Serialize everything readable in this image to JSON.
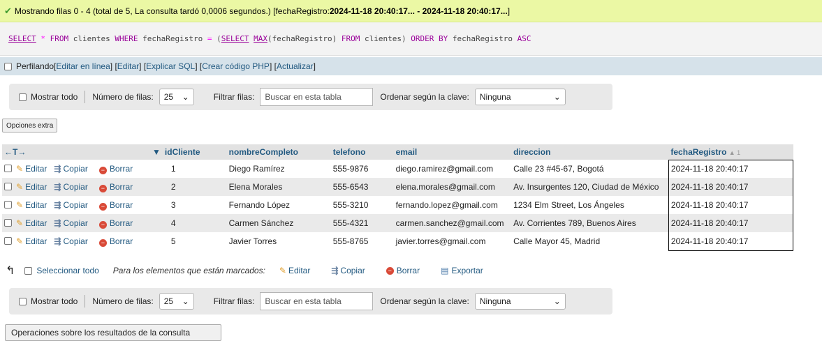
{
  "success": {
    "text": "Mostrando filas 0 - 4 (total de 5, La consulta tardó 0,0006 segundos.) [fechaRegistro: ",
    "range": "2024-11-18 20:40:17... - 2024-11-18 20:40:17...",
    "close": "]"
  },
  "sql": {
    "select": "SELECT",
    "star": "*",
    "from1": "FROM",
    "table1": "clientes",
    "where": "WHERE",
    "col1": "fechaRegistro",
    "eq": "=",
    "open": "(",
    "select2": "SELECT",
    "max": "MAX",
    "col2": "(fechaRegistro)",
    "from2": "FROM",
    "table2": "clientes",
    "close": ")",
    "orderby": "ORDER BY",
    "col3": "fechaRegistro",
    "asc": "ASC"
  },
  "profiling": {
    "label": "Perfilando",
    "open": " [ ",
    "edit_inline": "Editar en línea",
    "mid1": " ] [ ",
    "edit": "Editar",
    "mid2": " ] [ ",
    "explain": "Explicar SQL",
    "mid3": " ] [ ",
    "php": "Crear código PHP",
    "mid4": " ] [ ",
    "refresh": "Actualizar",
    "end": " ]"
  },
  "nav": {
    "show_all": "Mostrar todo",
    "rows_label": "Número de filas:",
    "rows_value": "25",
    "filter_label": "Filtrar filas:",
    "filter_placeholder": "Buscar en esta tabla",
    "sort_label": "Ordenar según la clave:",
    "sort_value": "Ninguna"
  },
  "extra_options": "Opciones extra",
  "columns": {
    "arrows": "←T→",
    "id": "idCliente",
    "name": "nombreCompleto",
    "phone": "telefono",
    "email": "email",
    "address": "direccion",
    "date": "fechaRegistro",
    "sort_badge": "▲ 1"
  },
  "actions": {
    "edit": "Editar",
    "copy": "Copiar",
    "delete": "Borrar"
  },
  "rows": [
    {
      "id": "1",
      "name": "Diego Ramírez",
      "phone": "555-9876",
      "email": "diego.ramirez@gmail.com",
      "address": "Calle 23 #45-67, Bogotá",
      "date": "2024-11-18 20:40:17"
    },
    {
      "id": "2",
      "name": "Elena Morales",
      "phone": "555-6543",
      "email": "elena.morales@gmail.com",
      "address": "Av. Insurgentes 120, Ciudad de México",
      "date": "2024-11-18 20:40:17"
    },
    {
      "id": "3",
      "name": "Fernando López",
      "phone": "555-3210",
      "email": "fernando.lopez@gmail.com",
      "address": "1234 Elm Street, Los Ángeles",
      "date": "2024-11-18 20:40:17"
    },
    {
      "id": "4",
      "name": "Carmen Sánchez",
      "phone": "555-4321",
      "email": "carmen.sanchez@gmail.com",
      "address": "Av. Corrientes 789, Buenos Aires",
      "date": "2024-11-18 20:40:17"
    },
    {
      "id": "5",
      "name": "Javier Torres",
      "phone": "555-8765",
      "email": "javier.torres@gmail.com",
      "address": "Calle Mayor 45, Madrid",
      "date": "2024-11-18 20:40:17"
    }
  ],
  "bulk": {
    "select_all": "Seleccionar todo",
    "marked_label": "Para los elementos que están marcados:",
    "edit": "Editar",
    "copy": "Copiar",
    "delete": "Borrar",
    "export": "Exportar"
  },
  "operations": "Operaciones sobre los resultados de la consulta"
}
